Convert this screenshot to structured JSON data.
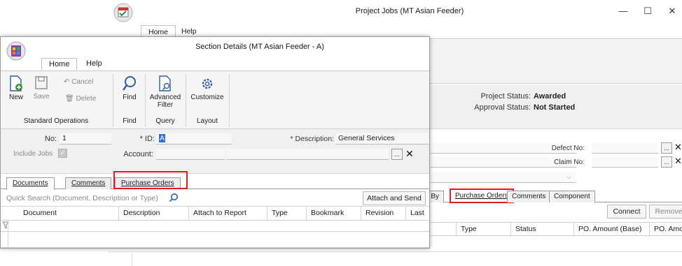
{
  "back_window": {
    "title": "Project Jobs (MT Asian Feeder)",
    "controls": {
      "minimize": "—",
      "maximize": "☐",
      "close": "✕"
    },
    "ribbon_tabs": [
      {
        "label": "Home"
      },
      {
        "label": "Help"
      }
    ],
    "project_status_label": "Project Status:",
    "project_status_value": "Awarded",
    "approval_status_label": "Approval Status:",
    "approval_status_value": "Not Started",
    "defect_no_label": "Defect No:",
    "claim_no_label": "Claim No:",
    "ellipsis": "...",
    "clear": "✕",
    "tabs": [
      {
        "label": "e By"
      },
      {
        "label": "Purchase Orders"
      },
      {
        "label": "Comments"
      },
      {
        "label": "Component"
      }
    ],
    "buttons": {
      "connect": "Connect",
      "remove": "Remove"
    },
    "grid_columns": [
      "Type",
      "Status",
      "PO. Amount (Base)",
      "PO. Amount"
    ]
  },
  "front_window": {
    "title": "Section Details (MT Asian Feeder - A)",
    "ribbon_tabs": [
      {
        "label": "Home"
      },
      {
        "label": "Help"
      }
    ],
    "ribbon": {
      "new": "New",
      "save": "Save",
      "cancel": "Cancel",
      "delete": "Delete",
      "find": "Find",
      "advanced_filter": [
        "Advanced",
        "Filter"
      ],
      "customize": "Customize",
      "groups": [
        "Standard Operations",
        "Find",
        "Query",
        "Layout"
      ]
    },
    "form": {
      "no_label": "No:",
      "no_value": "1",
      "include_jobs_label": "Include Jobs",
      "id_label": "* ID:",
      "id_value": "A",
      "description_label": "* Description:",
      "description_value": "General Services",
      "account_label": "Account:",
      "ellipsis": "...",
      "clear": "✕"
    },
    "tabs": [
      {
        "label": "Documents"
      },
      {
        "label": "Comments"
      },
      {
        "label": "Purchase Orders"
      }
    ],
    "search_placeholder": "Quick Search (Document, Description or Type)",
    "attach_and_send": "Attach and Send",
    "grid_columns": [
      "Document",
      "Description",
      "Attach to Report",
      "Type",
      "Bookmark",
      "Revision",
      "Last"
    ]
  },
  "colors": {
    "highlight": "#e21d1d",
    "selection": "#2f6fce"
  }
}
